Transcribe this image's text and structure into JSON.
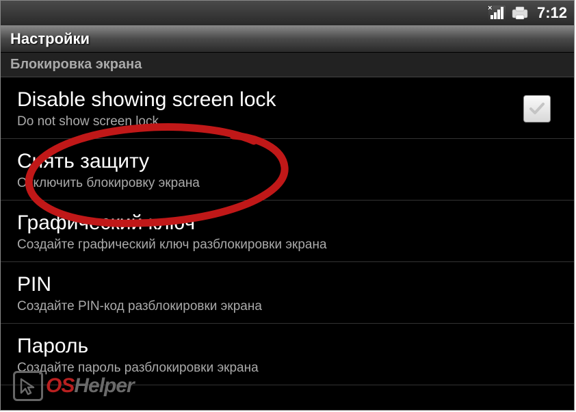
{
  "status": {
    "time": "7:12"
  },
  "titlebar": {
    "title": "Настройки"
  },
  "section": {
    "header": "Блокировка экрана"
  },
  "items": [
    {
      "title": "Disable showing screen lock",
      "subtitle": "Do not show screen lock",
      "hasCheckbox": true
    },
    {
      "title": "Снять защиту",
      "subtitle": "Отключить блокировку экрана"
    },
    {
      "title": "Графический ключ",
      "subtitle": "Создайте графический ключ разблокировки экрана"
    },
    {
      "title": "PIN",
      "subtitle": "Создайте PIN-код разблокировки экрана"
    },
    {
      "title": "Пароль",
      "subtitle": "Создайте пароль разблокировки экрана"
    }
  ],
  "watermark": {
    "part1": "OS",
    "part2": "Helper"
  }
}
